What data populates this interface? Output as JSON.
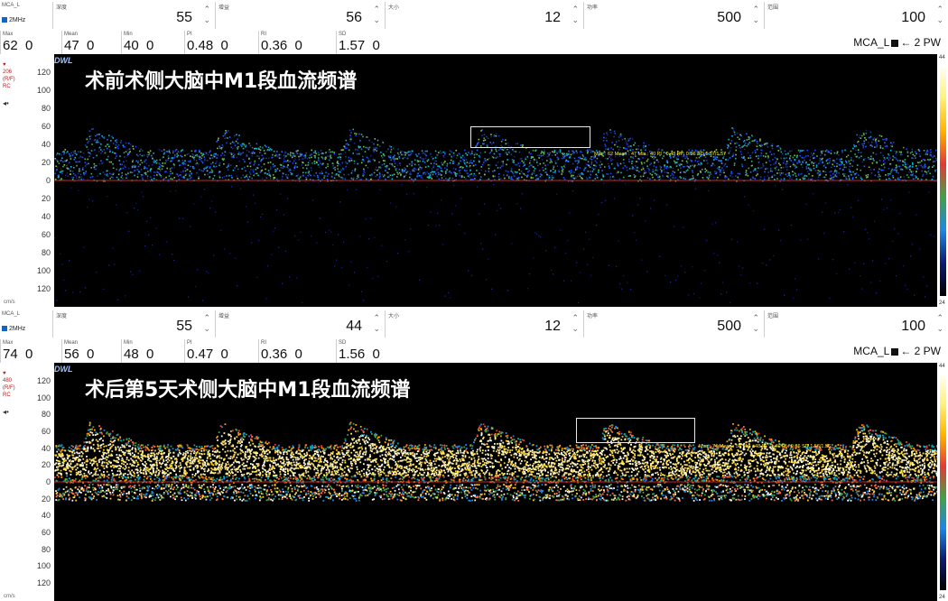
{
  "panels": [
    {
      "probe": {
        "name": "MCA_L",
        "freq": "2MHz"
      },
      "params": [
        {
          "label": "深度",
          "value": "55"
        },
        {
          "label": "增益",
          "value": "56"
        },
        {
          "label": "大小",
          "value": "12"
        },
        {
          "label": "功率",
          "value": "500"
        },
        {
          "label": "范围",
          "value": "100"
        }
      ],
      "measurements": [
        {
          "label": "Max",
          "value": "62",
          "sub": "0"
        },
        {
          "label": "Mean",
          "value": "47",
          "sub": "0"
        },
        {
          "label": "Min",
          "value": "40",
          "sub": "0"
        },
        {
          "label": "PI",
          "value": "0.48",
          "sub": "0"
        },
        {
          "label": "RI",
          "value": "0.36",
          "sub": "0"
        },
        {
          "label": "SD",
          "value": "1.57",
          "sub": "0"
        }
      ],
      "mode_label": "MCA_L",
      "mode_suffix": "2 PW",
      "left_info": "206",
      "left_info2": "(R/F)",
      "left_info3": "RC",
      "caption": "术前术侧大脑中M1段血流频谱",
      "dwl": "DWL",
      "measure_text": "Max : 62 Mean : 47 Min : 40 PI : 0.48 RI : 0.36 SD 1.57/1.57",
      "scale_top": "44",
      "scale_bottom": "24",
      "unit": "cm/s",
      "ticks": [
        "120",
        "100",
        "80",
        "60",
        "40",
        "20",
        "0",
        "20",
        "40",
        "60",
        "80",
        "100",
        "120"
      ]
    },
    {
      "probe": {
        "name": "MCA_L",
        "freq": "2MHz"
      },
      "params": [
        {
          "label": "深度",
          "value": "55"
        },
        {
          "label": "增益",
          "value": "44"
        },
        {
          "label": "大小",
          "value": "12"
        },
        {
          "label": "功率",
          "value": "500"
        },
        {
          "label": "范围",
          "value": "100"
        }
      ],
      "measurements": [
        {
          "label": "Max",
          "value": "74",
          "sub": "0"
        },
        {
          "label": "Mean",
          "value": "56",
          "sub": "0"
        },
        {
          "label": "Min",
          "value": "48",
          "sub": "0"
        },
        {
          "label": "PI",
          "value": "0.47",
          "sub": "0"
        },
        {
          "label": "RI",
          "value": "0.36",
          "sub": "0"
        },
        {
          "label": "SD",
          "value": "1.56",
          "sub": "0"
        }
      ],
      "mode_label": "MCA_L",
      "mode_suffix": "2 PW",
      "left_info": "480",
      "left_info2": "(R/F)",
      "left_info3": "RC",
      "caption": "术后第5天术侧大脑中M1段血流频谱",
      "dwl": "DWL",
      "measure_text": "Max : 74 Mean : 56 Min : 48 PI : 0.47 RI : 0.36 SD 1.56/1.56",
      "scale_top": "44",
      "scale_bottom": "24",
      "unit": "cm/s",
      "ticks": [
        "120",
        "100",
        "80",
        "60",
        "40",
        "20",
        "0",
        "20",
        "40",
        "60",
        "80",
        "100",
        "120"
      ]
    }
  ],
  "colors": {
    "baseline": "#c62828",
    "spectrum_bg": "#000000",
    "measure_text": "#ffeb3b",
    "caption": "#ffffff"
  },
  "icons": {
    "power": "power-icon",
    "speaker": "speaker-icon",
    "stepper": "stepper-icon",
    "probe": "probe-square-icon"
  }
}
